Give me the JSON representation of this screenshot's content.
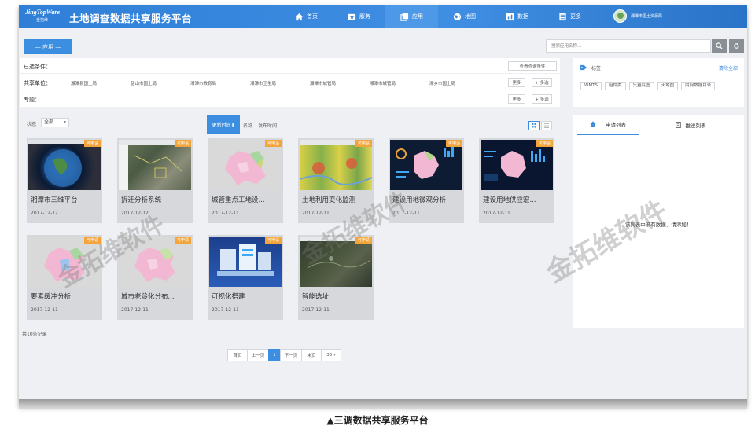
{
  "header": {
    "logo_en": "JingTopWare",
    "logo_cn": "金拓维",
    "title": "土地调查数据共享服务平台",
    "nav": [
      {
        "label": "首页",
        "icon": "home-icon"
      },
      {
        "label": "服务",
        "icon": "service-icon"
      },
      {
        "label": "应用",
        "icon": "apps-icon",
        "active": true
      },
      {
        "label": "地图",
        "icon": "globe-icon"
      },
      {
        "label": "数据",
        "icon": "data-icon"
      },
      {
        "label": "更多",
        "icon": "more-icon"
      }
    ],
    "user": "湘潭市国土资源局"
  },
  "toolbar": {
    "app_tab": "— 应用 —",
    "search_placeholder": "搜索应用名称..."
  },
  "filters": {
    "selected_label": "已选条件：",
    "save_query": "查看查询条件",
    "org_label": "共享单位：",
    "orgs": [
      "湘潭县国土局",
      "韶山市国土局",
      "湘潭市教育局",
      "湘潭市卫生局",
      "湘潭市城管局",
      "湘潭市城管局",
      "湘乡市国土局"
    ],
    "more": "更多",
    "multi": "+ 多选",
    "topic_label": "专题："
  },
  "tag_panel": {
    "label": "标签",
    "clear": "清除全部",
    "tags": [
      "WMTS",
      "组件类",
      "矢量底图",
      "天地图",
      "内网数据目录"
    ]
  },
  "sort": {
    "status_label": "状态",
    "status_value": "全部",
    "update_time": "更新时间⬇",
    "name": "名称",
    "publish_time": "发布时间"
  },
  "cards": [
    {
      "title": "湘潭市三维平台",
      "date": "2017-12-12",
      "badge": "可申请"
    },
    {
      "title": "拆迁分析系统",
      "date": "2017-12-12",
      "badge": "可申请"
    },
    {
      "title": "城管重点工地设...",
      "date": "2017-12-11",
      "badge": "可申请"
    },
    {
      "title": "土地利用变化监测",
      "date": "2017-12-11",
      "badge": "可申请"
    },
    {
      "title": "建设用地微观分析",
      "date": "2017-12-11",
      "badge": "可申请"
    },
    {
      "title": "建设用地供应宏...",
      "date": "2017-12-11",
      "badge": "可申请"
    },
    {
      "title": "要素缓冲分析",
      "date": "2017-12-11",
      "badge": "可申请"
    },
    {
      "title": "城市老龄化分布...",
      "date": "2017-12-11",
      "badge": "可申请"
    },
    {
      "title": "可视化搭建",
      "date": "2017-12-11",
      "badge": "可申请"
    },
    {
      "title": "智能选址",
      "date": "2017-12-11",
      "badge": "可申请"
    }
  ],
  "pagination": {
    "total": "共10条记录",
    "first": "首页",
    "prev": "上一页",
    "current": "1",
    "next": "下一页",
    "last": "末页",
    "page_size": "36"
  },
  "apply_panel": {
    "tab_apply": "申请列表",
    "tab_recommend": "推送列表",
    "empty": "该列表中没有数据，请添加！"
  },
  "watermark": "金拓维软件",
  "caption": "▲三调数据共享服务平台",
  "colors": {
    "header": "#3a88de",
    "accent": "#3c8ee0",
    "badge": "#f3a43a",
    "card": "#d7d8db"
  }
}
